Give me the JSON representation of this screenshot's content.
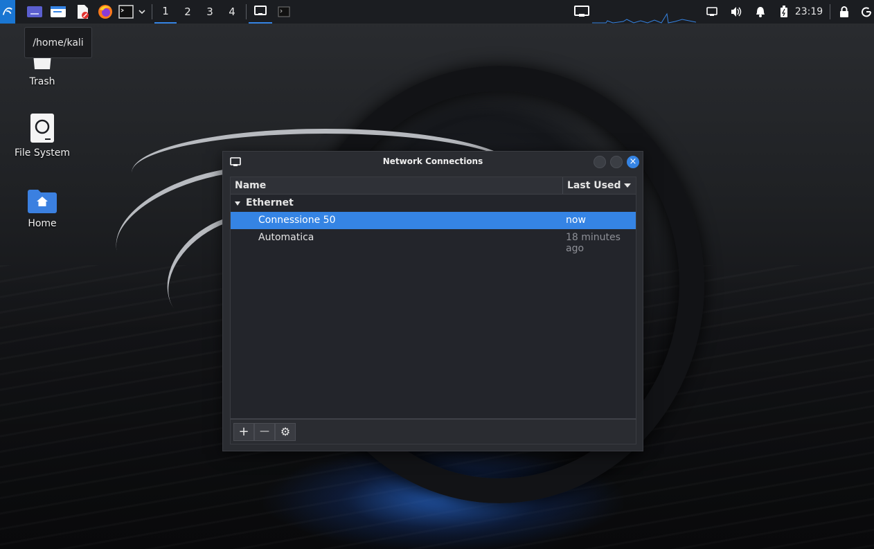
{
  "panel": {
    "workspaces": [
      "1",
      "2",
      "3",
      "4"
    ],
    "active_workspace": "1",
    "clock": "23:19"
  },
  "tooltip": {
    "text": "/home/kali"
  },
  "desktop": {
    "icons": [
      {
        "label": "Trash"
      },
      {
        "label": "File System"
      },
      {
        "label": "Home"
      }
    ]
  },
  "dialog": {
    "title": "Network Connections",
    "columns": {
      "name": "Name",
      "last_used": "Last Used"
    },
    "group": {
      "label": "Ethernet"
    },
    "connections": [
      {
        "name": "Connessione 50",
        "last_used": "now",
        "selected": true
      },
      {
        "name": "Automatica",
        "last_used": "18 minutes ago",
        "selected": false
      }
    ],
    "toolbar": {
      "add": "+",
      "remove": "—",
      "settings": "⚙"
    },
    "close_glyph": "×"
  },
  "colors": {
    "accent": "#3584e4",
    "panel_bg": "#1b1d21",
    "dialog_bg": "#2a2c31",
    "list_bg": "#23252b"
  },
  "icons": [
    "kali-menu-icon",
    "desktop-icon",
    "file-manager-icon",
    "text-editor-icon",
    "firefox-icon",
    "terminal-icon",
    "chevron-down-icon",
    "network-icon",
    "display-icon",
    "volume-icon",
    "bell-icon",
    "battery-icon",
    "lock-icon",
    "power-icon"
  ]
}
